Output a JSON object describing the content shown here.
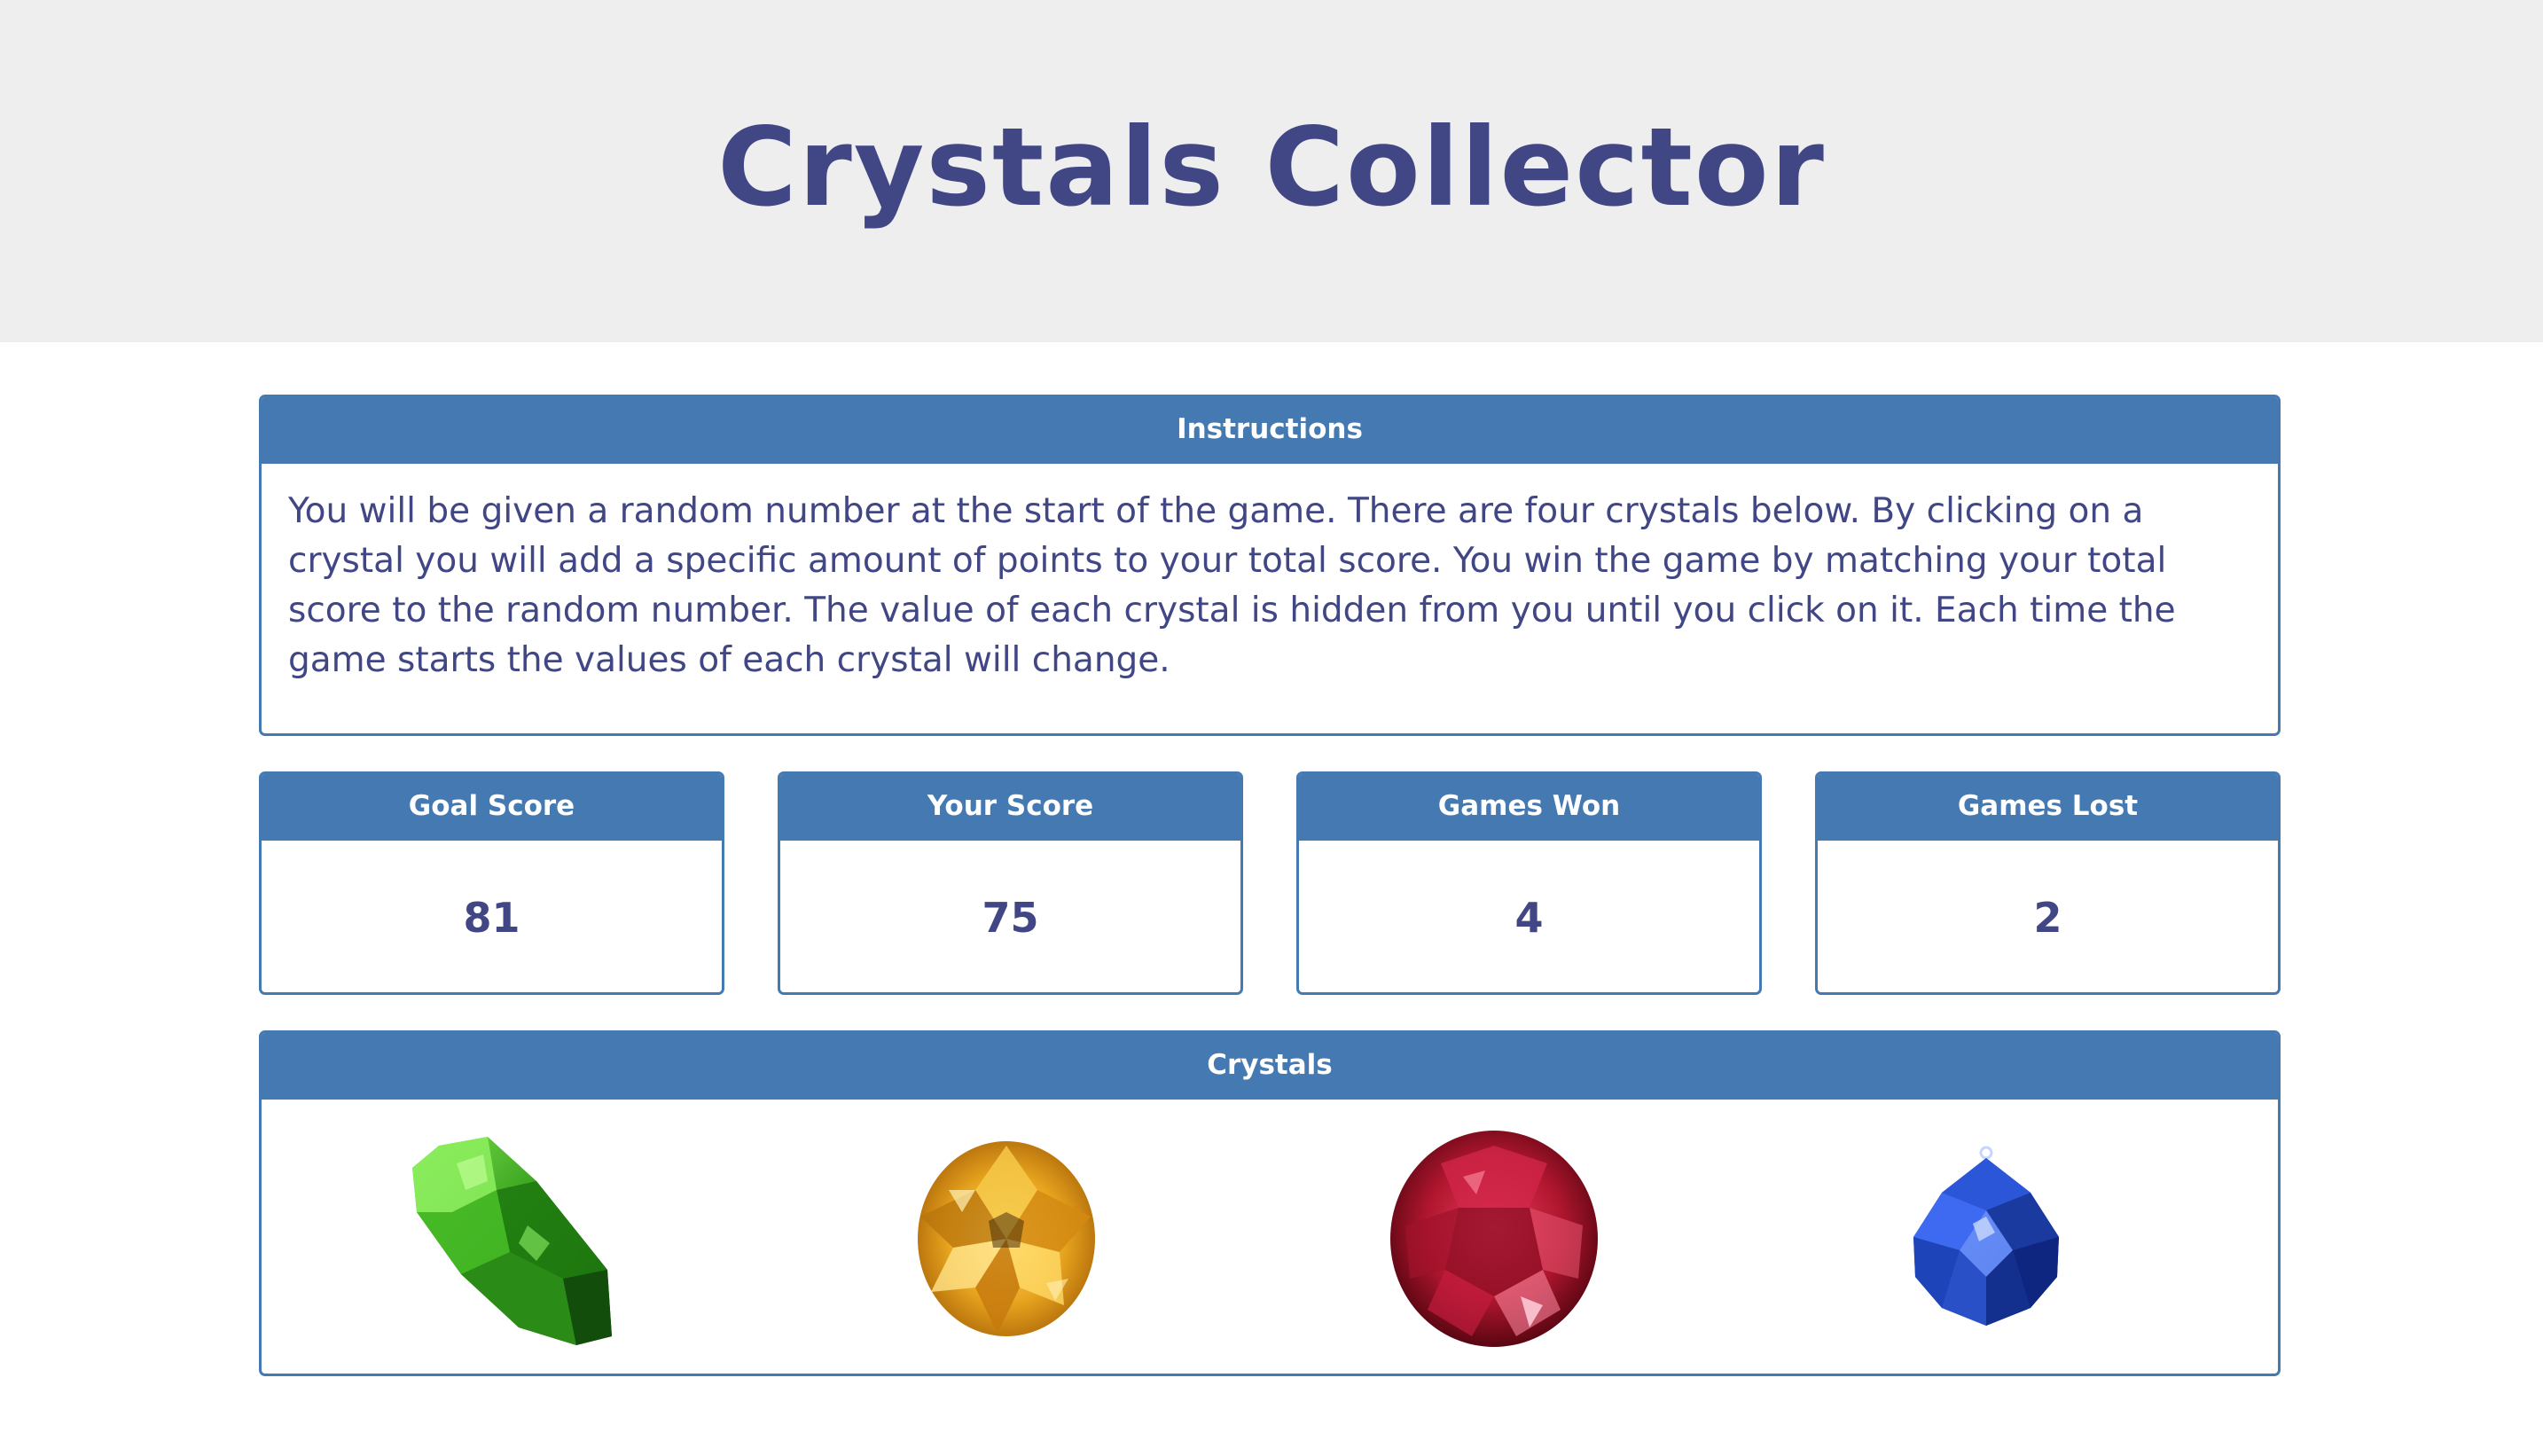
{
  "header": {
    "title": "Crystals Collector"
  },
  "instructions": {
    "heading": "Instructions",
    "text": "You will be given a random number at the start of the game. There are four crystals below. By clicking on a crystal you will add a specific amount of points to your total score. You win the game by matching your total score to the random number. The value of each crystal is hidden from you until you click on it. Each time the game starts the values of each crystal will change."
  },
  "scores": {
    "goal": {
      "label": "Goal Score",
      "value": "81"
    },
    "yours": {
      "label": "Your Score",
      "value": "75"
    },
    "won": {
      "label": "Games Won",
      "value": "4"
    },
    "lost": {
      "label": "Games Lost",
      "value": "2"
    }
  },
  "crystals": {
    "heading": "Crystals",
    "items": [
      {
        "name": "green-crystal",
        "color": "#3a9a1e"
      },
      {
        "name": "yellow-crystal",
        "color": "#e7a41e"
      },
      {
        "name": "red-crystal",
        "color": "#b0162e"
      },
      {
        "name": "blue-crystal",
        "color": "#1b3fae"
      }
    ]
  },
  "colors": {
    "accent": "#4479b2",
    "text": "#414685",
    "jumbotron_bg": "#eeeeee"
  }
}
